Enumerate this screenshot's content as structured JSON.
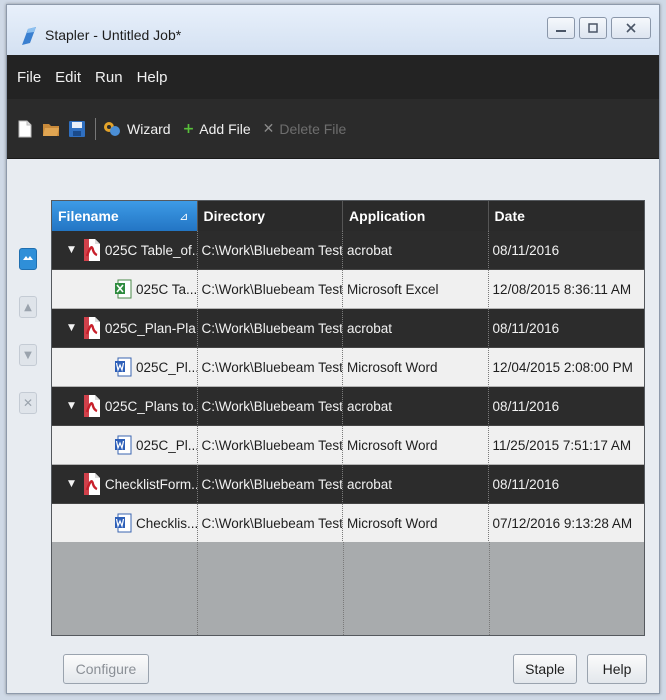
{
  "window": {
    "title": "Stapler - Untitled Job*",
    "controls": [
      "minimize",
      "restore",
      "close"
    ]
  },
  "menu": [
    "File",
    "Edit",
    "Run",
    "Help"
  ],
  "toolbar": {
    "wizard_label": "Wizard",
    "add_file_label": "Add File",
    "delete_file_label": "Delete File"
  },
  "grid": {
    "columns": [
      "Filename",
      "Directory",
      "Application",
      "Date"
    ],
    "sorted_column": "Filename",
    "rows": [
      {
        "type": "parent",
        "icon": "pdf-icon",
        "filename": "025C Table_of...",
        "directory": "C:\\Work\\Bluebeam Test...",
        "application": "acrobat",
        "date": "08/11/2016"
      },
      {
        "type": "child",
        "icon": "excel-icon",
        "filename": "025C Ta...",
        "directory": "C:\\Work\\Bluebeam Test...",
        "application": "Microsoft Excel",
        "date": "12/08/2015 8:36:11 AM"
      },
      {
        "type": "parent",
        "icon": "pdf-icon",
        "filename": "025C_Plan-Pla...",
        "directory": "C:\\Work\\Bluebeam Test...",
        "application": "acrobat",
        "date": "08/11/2016"
      },
      {
        "type": "child",
        "icon": "word-icon",
        "filename": "025C_Pl...",
        "directory": "C:\\Work\\Bluebeam Test...",
        "application": "Microsoft Word",
        "date": "12/04/2015 2:08:00 PM"
      },
      {
        "type": "parent",
        "icon": "pdf-icon",
        "filename": "025C_Plans to...",
        "directory": "C:\\Work\\Bluebeam Test...",
        "application": "acrobat",
        "date": "08/11/2016"
      },
      {
        "type": "child",
        "icon": "word-icon",
        "filename": "025C_Pl...",
        "directory": "C:\\Work\\Bluebeam Test...",
        "application": "Microsoft Word",
        "date": "11/25/2015 7:51:17 AM"
      },
      {
        "type": "parent",
        "icon": "pdf-icon",
        "filename": "ChecklistForm....",
        "directory": "C:\\Work\\Bluebeam Test...",
        "application": "acrobat",
        "date": "08/11/2016"
      },
      {
        "type": "child",
        "icon": "word-icon",
        "filename": "Checklis...",
        "directory": "C:\\Work\\Bluebeam Test...",
        "application": "Microsoft Word",
        "date": "07/12/2016 9:13:28 AM"
      }
    ]
  },
  "buttons": {
    "configure": "Configure",
    "staple": "Staple",
    "help": "Help"
  },
  "colors": {
    "accent": "#2f8fd8",
    "menubar": "#232323",
    "parent_row": "#2c2c2c",
    "child_row": "#f0f0f0",
    "pdf_red": "#c8202b"
  }
}
